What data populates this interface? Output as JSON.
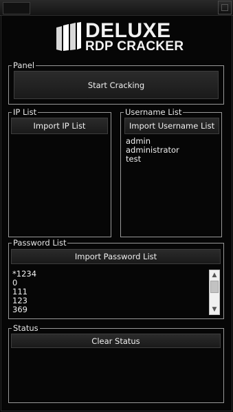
{
  "logo": {
    "line1": "DELUXE",
    "line2": "RDP CRACKER"
  },
  "panel": {
    "legend": "Panel",
    "start_button": "Start Cracking"
  },
  "ip_list": {
    "legend": "IP List",
    "import_button": "Import IP List",
    "items": []
  },
  "username_list": {
    "legend": "Username List",
    "import_button": "Import Username List",
    "items": [
      "admin",
      "administrator",
      "test"
    ]
  },
  "password_list": {
    "legend": "Password List",
    "import_button": "Import Password List",
    "items": [
      "*1234",
      "0",
      "111",
      "123",
      "369"
    ]
  },
  "status": {
    "legend": "Status",
    "clear_button": "Clear Status"
  }
}
